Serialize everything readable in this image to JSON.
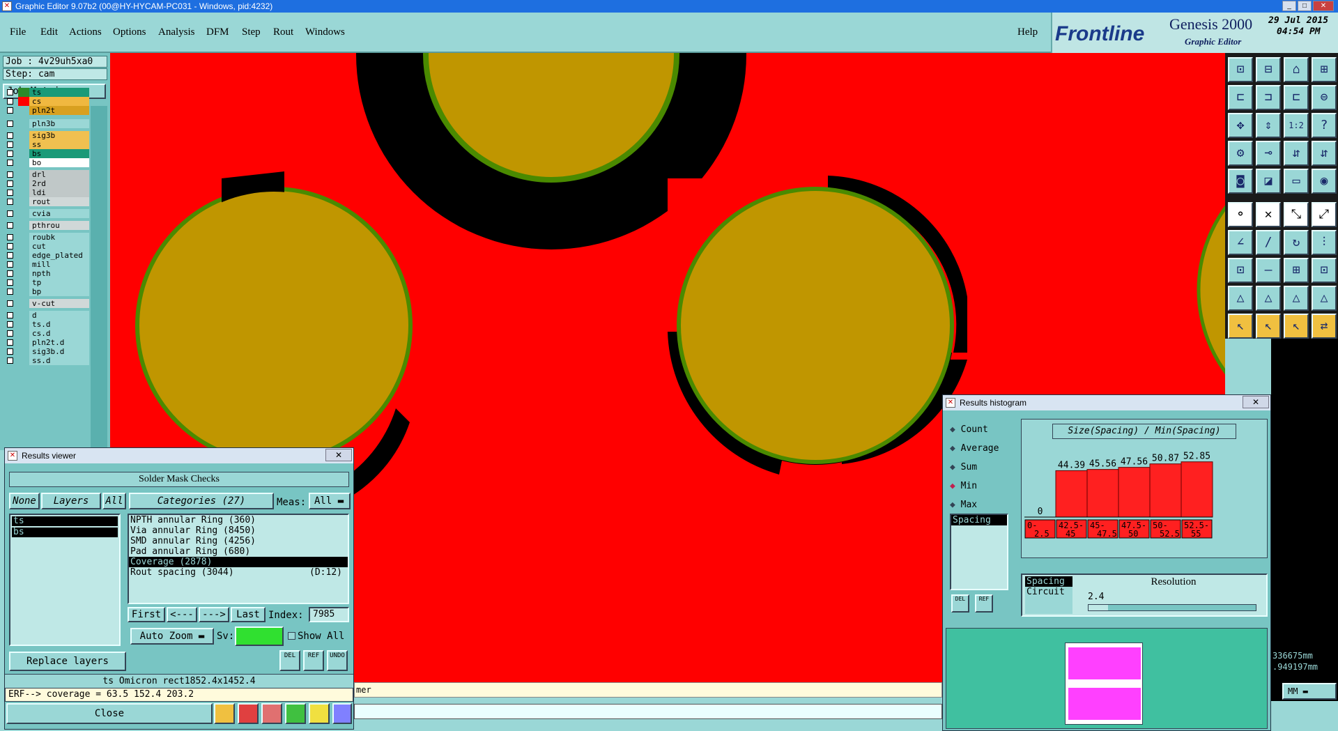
{
  "window": {
    "title": "Graphic Editor 9.07b2 (00@HY-HYCAM-PC031 - Windows, pid:4232)"
  },
  "menu": {
    "items": [
      "File",
      "Edit",
      "Actions",
      "Options",
      "Analysis",
      "DFM",
      "Step",
      "Rout",
      "Windows"
    ],
    "help": "Help"
  },
  "branding": {
    "logo": "Frontline",
    "product": "Genesis 2000",
    "subtitle": "Graphic Editor",
    "date": "29 Jul 2015",
    "time": "04:54 PM"
  },
  "job": {
    "job_label": "Job : 4v29uh5xa0",
    "step_label": "Step: cam",
    "matrix_button": "Job Matrix ..."
  },
  "layers": [
    {
      "name": "ts",
      "color": "#1a9a78"
    },
    {
      "name": "cs",
      "color": "#f0b840"
    },
    {
      "name": "pln2t",
      "color": "#d8a020"
    },
    {
      "name": "pln3b",
      "color": "#9ad7d6"
    },
    {
      "name": "sig3b",
      "color": "#f0c050"
    },
    {
      "name": "ss",
      "color": "#f0c050"
    },
    {
      "name": "bs",
      "color": "#1a9a78"
    },
    {
      "name": "bo",
      "color": "#ffffff"
    },
    {
      "name": "drl",
      "color": "#c0c8c8"
    },
    {
      "name": "2rd",
      "color": "#c0c8c8"
    },
    {
      "name": "ldi",
      "color": "#c0c8c8"
    },
    {
      "name": "rout",
      "color": "#d0d8d8"
    },
    {
      "name": "cvia",
      "color": "#9ad7d6"
    },
    {
      "name": "pthrou",
      "color": "#d0d8d8"
    },
    {
      "name": "roubk",
      "color": "#9ad7d6"
    },
    {
      "name": "cut",
      "color": "#9ad7d6"
    },
    {
      "name": "edge_plated",
      "color": "#9ad7d6"
    },
    {
      "name": "mill",
      "color": "#9ad7d6"
    },
    {
      "name": "npth",
      "color": "#9ad7d6"
    },
    {
      "name": "tp",
      "color": "#9ad7d6"
    },
    {
      "name": "bp",
      "color": "#9ad7d6"
    },
    {
      "name": "v-cut",
      "color": "#d0d8d8"
    },
    {
      "name": "d",
      "color": "#9ad7d6"
    },
    {
      "name": "ts.d",
      "color": "#9ad7d6"
    },
    {
      "name": "cs.d",
      "color": "#9ad7d6"
    },
    {
      "name": "pln2t.d",
      "color": "#9ad7d6"
    },
    {
      "name": "sig3b.d",
      "color": "#9ad7d6"
    },
    {
      "name": "ss.d",
      "color": "#9ad7d6"
    }
  ],
  "results_viewer": {
    "title": "Results viewer",
    "header": "Solder Mask Checks",
    "none_btn": "None",
    "layers_btn": "Layers",
    "all_btn": "All",
    "categories_label": "Categories (27)",
    "meas_label": "Meas:",
    "meas_value": "All",
    "layer_list": [
      "ts",
      "bs"
    ],
    "categories": [
      "NPTH annular Ring (360)",
      "Via annular Ring (8450)",
      "SMD annular Ring (4256)",
      "Pad annular Ring (680)",
      "Coverage (2878)",
      "Rout spacing (3044)"
    ],
    "rout_extra": "(D:12)",
    "first": "First",
    "prev": "<---",
    "next": "--->",
    "last": "Last",
    "index_label": "Index:",
    "index_value": "7985",
    "auto_zoom": "Auto Zoom",
    "sv_label": "Sv:",
    "show_all": "Show All",
    "replace_layers": "Replace layers",
    "del": "DEL",
    "ref": "REF",
    "undo": "UNDO",
    "info_line": "ts Omicron   rect1852.4x1452.4",
    "erf_line": "ERF--> coverage = 63.5 152.4 203.2",
    "close": "Close"
  },
  "histogram": {
    "title": "Results histogram",
    "options": [
      "Count",
      "Average",
      "Sum",
      "Min",
      "Max"
    ],
    "selected": "Min",
    "chart_title": "Size(Spacing) / Min(Spacing)",
    "list1": [
      "Spacing"
    ],
    "list2": [
      "Spacing",
      "Circuit"
    ],
    "resolution_label": "Resolution",
    "resolution_value": "2.4",
    "del": "DEL",
    "ref": "REF"
  },
  "chart_data": {
    "type": "bar",
    "title": "Size(Spacing) / Min(Spacing)",
    "categories": [
      "0-2.5",
      "42.5-45",
      "45-47.5",
      "47.5-50",
      "50-52.5",
      "52.5-55"
    ],
    "values": [
      0,
      44.39,
      45.56,
      47.56,
      50.87,
      52.85
    ],
    "color": "#ff2020"
  },
  "status": {
    "message": "mer",
    "unit": "MM",
    "coord_x": "336675mm",
    "coord_y": ".949197mm"
  }
}
